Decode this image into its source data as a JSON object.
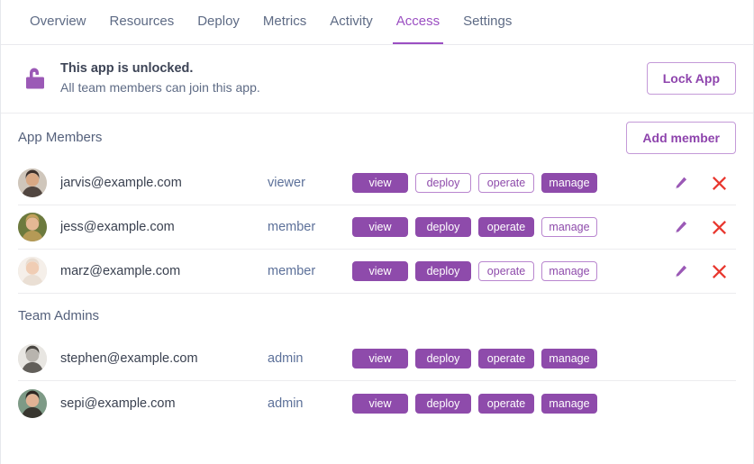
{
  "nav": {
    "tabs": [
      {
        "label": "Overview",
        "active": false
      },
      {
        "label": "Resources",
        "active": false
      },
      {
        "label": "Deploy",
        "active": false
      },
      {
        "label": "Metrics",
        "active": false
      },
      {
        "label": "Activity",
        "active": false
      },
      {
        "label": "Access",
        "active": true
      },
      {
        "label": "Settings",
        "active": false
      }
    ]
  },
  "banner": {
    "icon": "unlocked-padlock-icon",
    "title": "This app is unlocked.",
    "subtitle": "All team members can join this app.",
    "action_label": "Lock App"
  },
  "members_section": {
    "title": "App Members",
    "action_label": "Add member"
  },
  "admins_section": {
    "title": "Team Admins"
  },
  "permission_labels": [
    "view",
    "deploy",
    "operate",
    "manage"
  ],
  "row_actions": {
    "edit_icon": "pencil-icon",
    "delete_icon": "close-x-icon"
  },
  "members": [
    {
      "email": "jarvis@example.com",
      "role": "viewer",
      "permissions": [
        true,
        false,
        false,
        true
      ],
      "avatar": {
        "skin": "#d8a884",
        "hair": "#3b2f2a",
        "bg": "#cfc6bb"
      },
      "has_actions": true
    },
    {
      "email": "jess@example.com",
      "role": "member",
      "permissions": [
        true,
        true,
        true,
        false
      ],
      "avatar": {
        "skin": "#e4b894",
        "hair": "#c2a05a",
        "bg": "#6c7a3e"
      },
      "has_actions": true
    },
    {
      "email": "marz@example.com",
      "role": "member",
      "permissions": [
        true,
        true,
        false,
        false
      ],
      "avatar": {
        "skin": "#f0cdb4",
        "hair": "#e8dcd0",
        "bg": "#f5efe9"
      },
      "has_actions": true
    }
  ],
  "admins": [
    {
      "email": "stephen@example.com",
      "role": "admin",
      "permissions": [
        true,
        true,
        true,
        true
      ],
      "avatar": {
        "skin": "#b8b4ae",
        "hair": "#4a4742",
        "bg": "#e8e6e2"
      },
      "has_actions": false
    },
    {
      "email": "sepi@example.com",
      "role": "admin",
      "permissions": [
        true,
        true,
        true,
        true
      ],
      "avatar": {
        "skin": "#e0b294",
        "hair": "#2c2420",
        "bg": "#7d9a86"
      },
      "has_actions": false
    }
  ],
  "colors": {
    "accent": "#8e4bab",
    "accent_text": "#9b4fc2",
    "delete": "#e8382f",
    "email_text": "#3a4150",
    "role_text": "#5c7099"
  }
}
